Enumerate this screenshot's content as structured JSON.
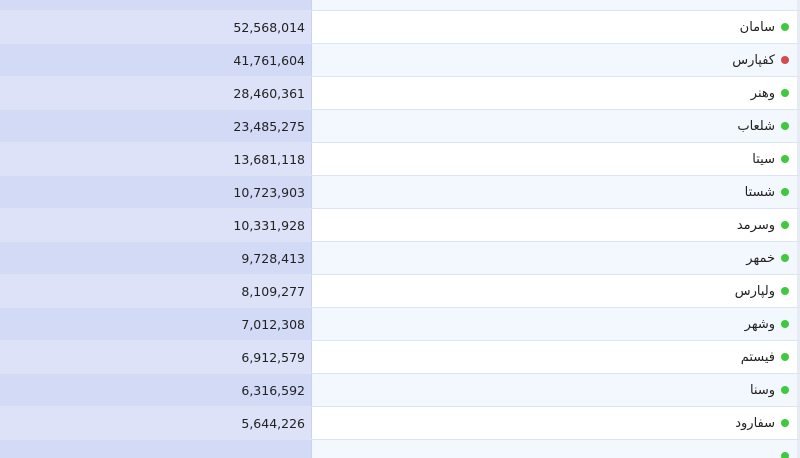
{
  "colors": {
    "up": "#3fc93f",
    "down": "#d34b4b"
  },
  "rows": [
    {
      "name": "",
      "value": "",
      "status": "up"
    },
    {
      "name": "سامان",
      "value": "52,568,014",
      "status": "up"
    },
    {
      "name": "کفپارس",
      "value": "41,761,604",
      "status": "down"
    },
    {
      "name": "وهنر",
      "value": "28,460,361",
      "status": "up"
    },
    {
      "name": "شلعاب",
      "value": "23,485,275",
      "status": "up"
    },
    {
      "name": "سیتا",
      "value": "13,681,118",
      "status": "up"
    },
    {
      "name": "شستا",
      "value": "10,723,903",
      "status": "up"
    },
    {
      "name": "وسرمد",
      "value": "10,331,928",
      "status": "up"
    },
    {
      "name": "خمهر",
      "value": "9,728,413",
      "status": "up"
    },
    {
      "name": "ولپارس",
      "value": "8,109,277",
      "status": "up"
    },
    {
      "name": "وشهر",
      "value": "7,012,308",
      "status": "up"
    },
    {
      "name": "فیستم",
      "value": "6,912,579",
      "status": "up"
    },
    {
      "name": "وسنا",
      "value": "6,316,592",
      "status": "up"
    },
    {
      "name": "سفارود",
      "value": "5,644,226",
      "status": "up"
    },
    {
      "name": "",
      "value": "",
      "status": "up"
    }
  ]
}
